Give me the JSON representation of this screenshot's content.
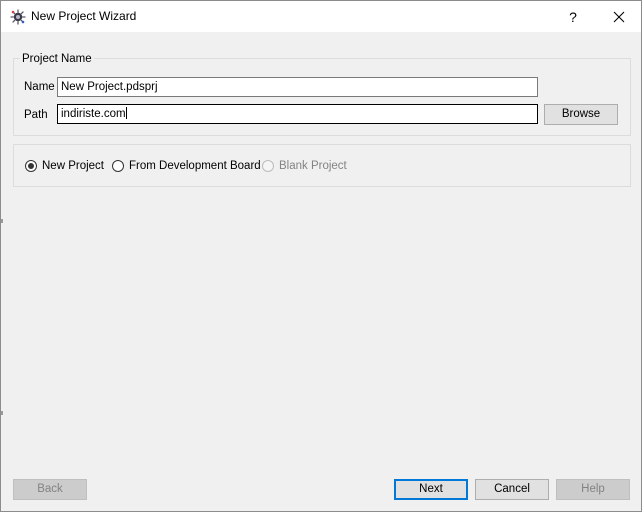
{
  "window": {
    "title": "New Project Wizard",
    "help_label": "?"
  },
  "project_name": {
    "group_label": "Project Name",
    "name_label": "Name",
    "name_value": "New Project.pdsprj",
    "path_label": "Path",
    "path_value": "indiriste.com",
    "browse_label": "Browse"
  },
  "project_type": {
    "options": [
      {
        "label": "New Project",
        "checked": true,
        "enabled": true
      },
      {
        "label": "From Development Board",
        "checked": false,
        "enabled": true
      },
      {
        "label": "Blank Project",
        "checked": false,
        "enabled": false
      }
    ]
  },
  "footer": {
    "back_label": "Back",
    "next_label": "Next",
    "cancel_label": "Cancel",
    "help_label": "Help"
  },
  "icons": {
    "app": "proteus-app-icon",
    "close": "close-icon"
  },
  "colors": {
    "dialog_bg": "#f0f0f0",
    "titlebar_bg": "#ffffff",
    "default_button_border": "#0078d7",
    "disabled_text": "#838383"
  }
}
